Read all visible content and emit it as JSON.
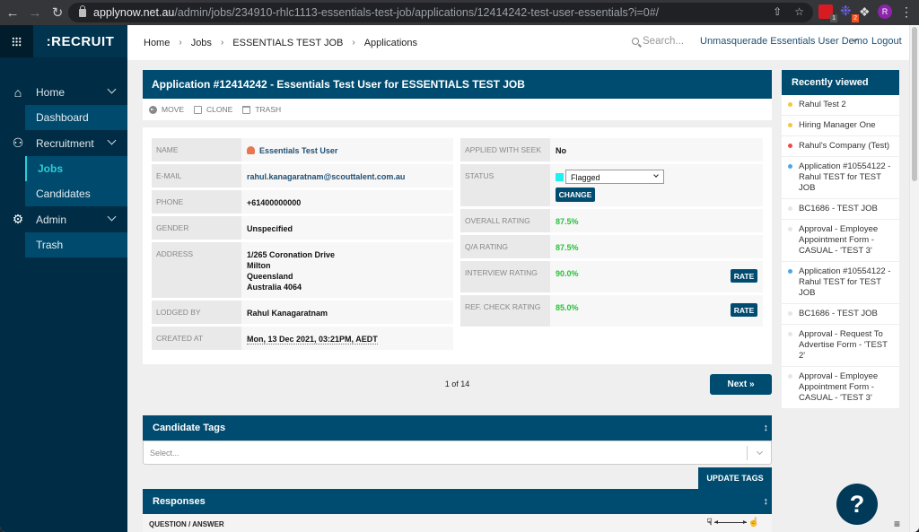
{
  "browser": {
    "url_host": "applynow.net.au",
    "url_path": "/admin/jobs/234910-rhlc1113-essentials-test-job/applications/12414242-test-user-essentials?i=0#/",
    "ext1_badge": "1",
    "ext2_badge": "2",
    "profile_initial": "R"
  },
  "sidebar": {
    "brand": ":RECRUIT",
    "groups": [
      {
        "label": "Home",
        "items": [
          {
            "label": "Dashboard"
          }
        ]
      },
      {
        "label": "Recruitment",
        "items": [
          {
            "label": "Jobs",
            "active": true
          },
          {
            "label": "Candidates"
          }
        ]
      },
      {
        "label": "Admin",
        "items": [
          {
            "label": "Trash"
          }
        ]
      }
    ]
  },
  "topbar": {
    "breadcrumb": [
      "Home",
      "Jobs",
      "ESSENTIALS TEST JOB",
      "Applications"
    ],
    "search_placeholder": "Search...",
    "user_menu": "Unmasquerade Essentials User Demo",
    "logout": "Logout"
  },
  "application": {
    "title": "Application #12414242 - Essentials Test User for ESSENTIALS TEST JOB",
    "actions": {
      "move": "MOVE",
      "clone": "CLONE",
      "trash": "TRASH"
    },
    "left_fields": [
      {
        "label": "NAME",
        "value": "Essentials Test User"
      },
      {
        "label": "E-MAIL",
        "value": "rahul.kanagaratnam@scouttalent.com.au"
      },
      {
        "label": "PHONE",
        "value": "+61400000000"
      },
      {
        "label": "GENDER",
        "value": "Unspecified"
      },
      {
        "label": "ADDRESS",
        "lines": [
          "1/265 Coronation Drive",
          "Milton",
          "Queensland",
          "Australia 4064"
        ]
      },
      {
        "label": "LODGED BY",
        "value": "Rahul Kanagaratnam"
      },
      {
        "label": "CREATED AT",
        "value": "Mon, 13 Dec 2021, 03:21PM, AEDT"
      }
    ],
    "right_fields": [
      {
        "label": "APPLIED WITH SEEK",
        "value": "No"
      },
      {
        "label": "STATUS",
        "value": "Flagged",
        "status_color": "#1ef0f0",
        "button": "CHANGE"
      },
      {
        "label": "OVERALL RATING",
        "value": "87.5%"
      },
      {
        "label": "Q/A RATING",
        "value": "87.5%"
      },
      {
        "label": "INTERVIEW RATING",
        "value": "90.0%",
        "button": "RATE"
      },
      {
        "label": "REF. CHECK RATING",
        "value": "85.0%",
        "button": "RATE"
      }
    ]
  },
  "pager": {
    "text": "1 of 14",
    "next": "Next »"
  },
  "candidate_tags": {
    "title": "Candidate Tags",
    "placeholder": "Select...",
    "update_button": "UPDATE TAGS"
  },
  "responses": {
    "title": "Responses",
    "column": "QUESTION / ANSWER"
  },
  "recently_viewed": {
    "title": "Recently viewed",
    "items": [
      {
        "label": "Rahul Test 2",
        "color": "#f2c744"
      },
      {
        "label": "Hiring Manager One",
        "color": "#f2c744"
      },
      {
        "label": "Rahul's Company (Test)",
        "color": "#e84c4c"
      },
      {
        "label": "Application #10554122 - Rahul TEST for TEST JOB",
        "color": "#4aa8e8"
      },
      {
        "label": "BC1686 - TEST JOB",
        "color": "#e6e6e6"
      },
      {
        "label": "Approval - Employee Appointment Form - CASUAL - 'TEST 3'",
        "color": "#e6e6e6"
      },
      {
        "label": "Application #10554122 - Rahul TEST for TEST JOB",
        "color": "#4aa8e8"
      },
      {
        "label": "BC1686 - TEST JOB",
        "color": "#e6e6e6"
      },
      {
        "label": "Approval - Request To Advertise Form - 'TEST 2'",
        "color": "#e6e6e6"
      },
      {
        "label": "Approval - Employee Appointment Form - CASUAL - 'TEST 3'",
        "color": "#e6e6e6"
      }
    ]
  },
  "help": {
    "label": "?"
  },
  "colors": {
    "primary": "#004c70",
    "sidebar": "#002d45",
    "accent": "#27d0d8",
    "rating": "#27c13a"
  }
}
